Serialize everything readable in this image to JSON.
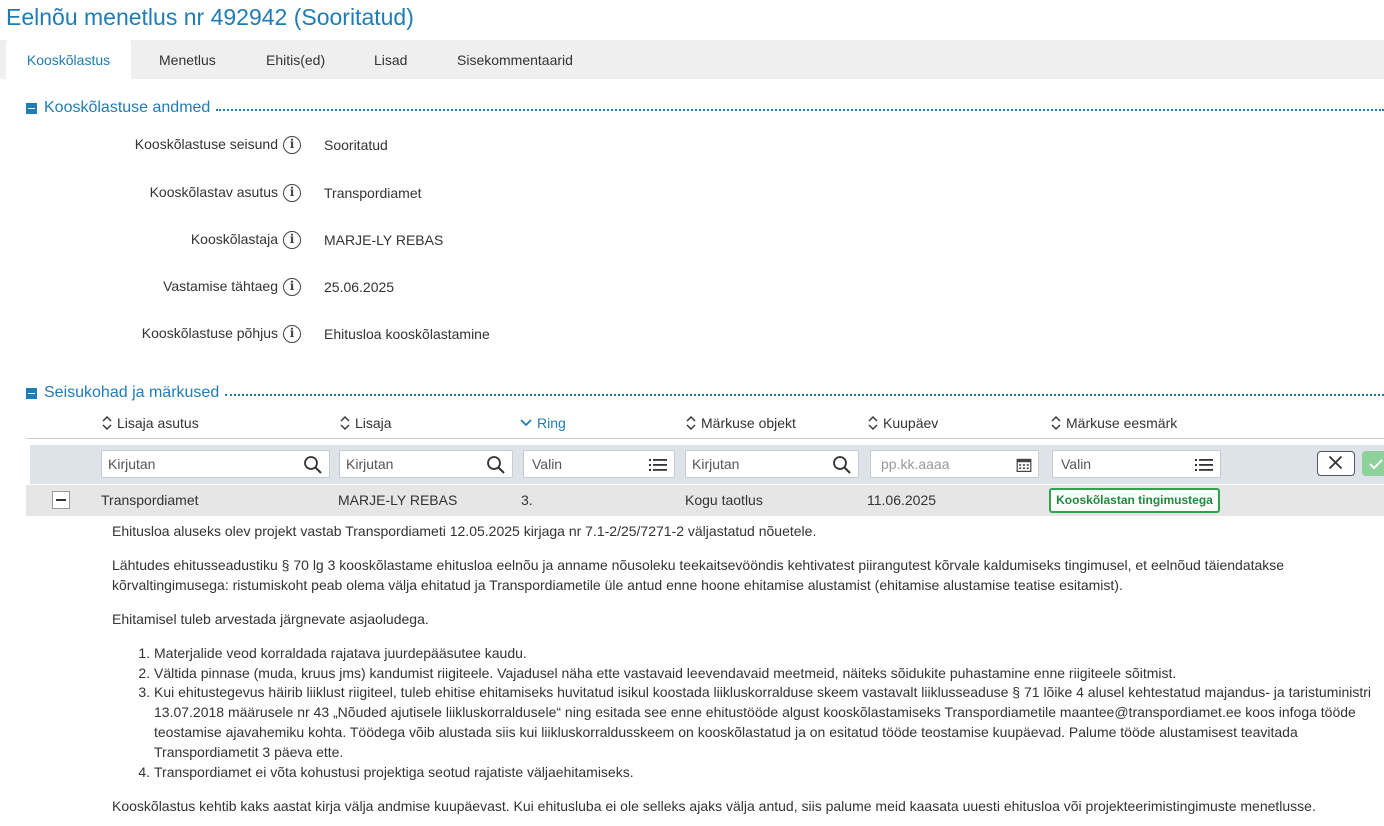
{
  "page": {
    "title": "Eelnõu menetlus nr 492942 (Sooritatud)"
  },
  "tabs": [
    {
      "label": "Kooskõlastus",
      "active": true
    },
    {
      "label": "Menetlus"
    },
    {
      "label": "Ehitis(ed)"
    },
    {
      "label": "Lisad"
    },
    {
      "label": "Sisekommentaarid"
    }
  ],
  "section1": {
    "title": "Kooskõlastuse andmed",
    "fields": [
      {
        "label": "Kooskõlastuse seisund",
        "value": "Sooritatud"
      },
      {
        "label": "Kooskõlastav asutus",
        "value": "Transpordiamet"
      },
      {
        "label": "Kooskõlastaja",
        "value": "MARJE-LY REBAS"
      },
      {
        "label": "Vastamise tähtaeg",
        "value": "25.06.2025"
      },
      {
        "label": "Kooskõlastuse põhjus",
        "value": "Ehitusloa kooskõlastamine"
      }
    ],
    "info_icon": "info-icon"
  },
  "section2": {
    "title": "Seisukohad ja märkused",
    "columns": [
      {
        "label": "Lisaja asutus",
        "sort": "none"
      },
      {
        "label": "Lisaja",
        "sort": "none"
      },
      {
        "label": "Ring",
        "sort": "desc"
      },
      {
        "label": "Märkuse objekt",
        "sort": "none"
      },
      {
        "label": "Kuupäev",
        "sort": "none"
      },
      {
        "label": "Märkuse eesmärk",
        "sort": "none"
      }
    ],
    "filters": [
      {
        "placeholder": "Kirjutan",
        "icon": "search-icon"
      },
      {
        "placeholder": "Kirjutan",
        "icon": "search-icon"
      },
      {
        "placeholder": "Valin",
        "icon": "list-icon"
      },
      {
        "placeholder": "Kirjutan",
        "icon": "search-icon"
      },
      {
        "placeholder": "pp.kk.aaaa",
        "icon": "calendar-icon"
      },
      {
        "placeholder": "Valin",
        "icon": "list-icon"
      }
    ],
    "row": {
      "asutus": "Transpordiamet",
      "lisaja": "MARJE-LY REBAS",
      "ring": "3.",
      "objekt": "Kogu taotlus",
      "kuupaev": "11.06.2025",
      "eesmark": "Kooskõlastan tingimustega",
      "eesmark_color": "#2ea44f"
    },
    "body": {
      "p1": "Ehitusloa aluseks olev projekt vastab Transpordiameti 12.05.2025 kirjaga nr 7.1-2/25/7271-2 väljastatud nõuetele.",
      "p2_line1": "Lähtudes ehitusseadustiku § 70 lg 3 kooskõlastame ehitusloa eelnõu ja anname nõusoleku teekaitsevööndis kehtivatest piirangutest kõrvale kaldumiseks tingimusel, et eelnõud täiendatakse",
      "p2_line2": "kõrvaltingimusega: ristumiskoht peab olema välja ehitatud ja Transpordiametile üle antud enne hoone ehitamise alustamist (ehitamise alustamise teatise esitamist).",
      "p3": "Ehitamisel tuleb arvestada järgnevate asjaoludega.",
      "list": [
        {
          "num": "1.",
          "lines": [
            "Materjalide veod korraldada rajatava juurdepääsutee kaudu."
          ]
        },
        {
          "num": "2.",
          "lines": [
            "Vältida pinnase (muda, kruus jms) kandumist riigiteele. Vajadusel näha ette vastavaid leevendavaid meetmeid, näiteks sõidukite puhastamine enne riigiteele sõitmist."
          ]
        },
        {
          "num": "3.",
          "lines": [
            "Kui ehitustegevus häirib liiklust riigiteel, tuleb ehitise ehitamiseks huvitatud isikul koostada liikluskorralduse skeem vastavalt liiklusseaduse § 71 lõike 4 alusel kehtestatud majandus- ja taristuministri",
            "13.07.2018 määrusele nr 43 „Nõuded ajutisele liikluskorraldusele“ ning esitada see enne ehitustööde algust kooskõlastamiseks Transpordiametile maantee@transpordiamet.ee koos infoga tööde",
            "teostamise ajavahemiku kohta. Töödega võib alustada siis kui liikluskorraldusskeem on kooskõlastatud ja on esitatud tööde teostamise kuupäevad. Palume tööde alustamisest teavitada",
            "Transpordiametit 3 päeva ette."
          ]
        },
        {
          "num": "4.",
          "lines": [
            "Transpordiamet ei võta kohustusi projektiga seotud rajatiste väljaehitamiseks."
          ]
        }
      ],
      "p4": "Kooskõlastus kehtib kaks aastat kirja välja andmise kuupäevast. Kui ehitusluba ei ole selleks ajaks välja antud, siis palume meid kaasata uuesti ehitusloa või projekteerimistingimuste menetlusse."
    }
  },
  "colors": {
    "accent": "#1f7cb5",
    "tabbar": "#efefef",
    "filter_row": "#dde3e8",
    "data_row": "#e6e6e6",
    "ok_button": "#8fd19a"
  }
}
